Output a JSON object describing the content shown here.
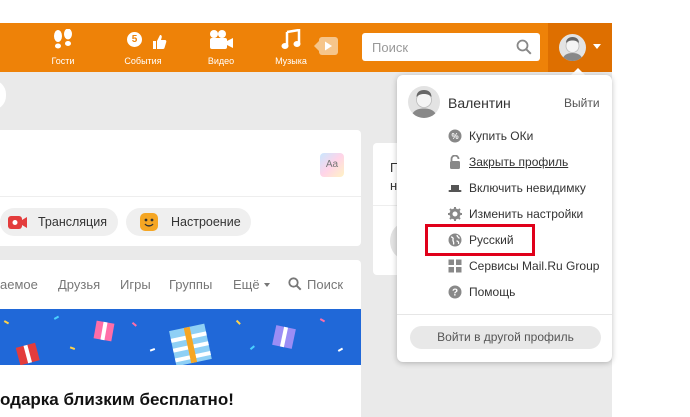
{
  "colors": {
    "brand": "#ee8208",
    "highlight": "#e0001a",
    "banner": "#2068d8"
  },
  "nav": {
    "guests": {
      "label": "Гости",
      "icon": "footprints-icon"
    },
    "events": {
      "label": "События",
      "icon": "thumbs-up-icon",
      "badge": "5"
    },
    "video": {
      "label": "Видео",
      "icon": "video-camera-icon"
    },
    "music": {
      "label": "Музыка",
      "icon": "music-note-icon"
    }
  },
  "search": {
    "placeholder": "Поиск"
  },
  "post": {
    "aa_label": "Aa",
    "broadcast_label": "Трансляция",
    "mood_label": "Настроение"
  },
  "tabs": [
    "аемое",
    "Друзья",
    "Игры",
    "Группы",
    "Ещё",
    "Поиск"
  ],
  "promo_text": "одарка близким бесплатно!",
  "side_card_fragment": [
    "П",
    "н"
  ],
  "dropdown": {
    "user_name": "Валентин",
    "logout": "Выйти",
    "items": [
      {
        "label": "Купить ОКи",
        "icon": "coin-icon"
      },
      {
        "label": "Закрыть профиль",
        "icon": "lock-icon"
      },
      {
        "label": "Включить невидимку",
        "icon": "hat-icon"
      },
      {
        "label": "Изменить настройки",
        "icon": "gear-icon"
      },
      {
        "label": "Русский",
        "icon": "globe-icon"
      },
      {
        "label": "Сервисы Mail.Ru Group",
        "icon": "grid-icon"
      },
      {
        "label": "Помощь",
        "icon": "help-icon"
      }
    ],
    "switch_profile": "Войти в другой профиль"
  }
}
